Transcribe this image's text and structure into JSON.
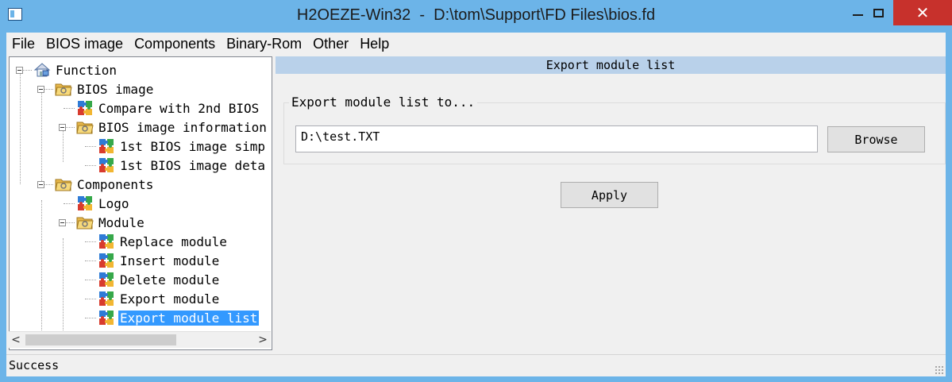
{
  "window": {
    "title": "H2OEZE-Win32  -  D:\\tom\\Support\\FD Files\\bios.fd",
    "close_glyph": "✕"
  },
  "menu": [
    "File",
    "BIOS image",
    "Components",
    "Binary-Rom",
    "Other",
    "Help"
  ],
  "tree": {
    "items": [
      {
        "label": "Function",
        "icon": "home-computer-icon",
        "expanded": true
      },
      {
        "label": "BIOS image",
        "icon": "folder-icon",
        "expanded": true
      },
      {
        "label": "Compare with 2nd BIOS",
        "icon": "puzzle-icon"
      },
      {
        "label": "BIOS image information",
        "icon": "folder-icon",
        "expanded": true
      },
      {
        "label": "1st BIOS image simp",
        "icon": "puzzle-icon"
      },
      {
        "label": "1st BIOS image deta",
        "icon": "puzzle-icon"
      },
      {
        "label": "Components",
        "icon": "folder-icon",
        "expanded": true
      },
      {
        "label": "Logo",
        "icon": "puzzle-icon"
      },
      {
        "label": "Module",
        "icon": "folder-icon",
        "expanded": true
      },
      {
        "label": "Replace module",
        "icon": "puzzle-icon"
      },
      {
        "label": "Insert module",
        "icon": "puzzle-icon"
      },
      {
        "label": "Delete module",
        "icon": "puzzle-icon"
      },
      {
        "label": "Export module",
        "icon": "puzzle-icon"
      },
      {
        "label": "Export module list",
        "icon": "puzzle-icon",
        "selected": true
      }
    ],
    "scroll_left": "<",
    "scroll_right": ">"
  },
  "panel": {
    "header": "Export module list",
    "group_label": "Export module list to...",
    "path_value": "D:\\test.TXT",
    "browse_label": "Browse",
    "apply_label": "Apply"
  },
  "status": {
    "text": "Success"
  },
  "colors": {
    "titlebar": "#6cb4e8",
    "close": "#c7312c",
    "selection": "#3399ff",
    "panel_header": "#b9d1ea"
  }
}
